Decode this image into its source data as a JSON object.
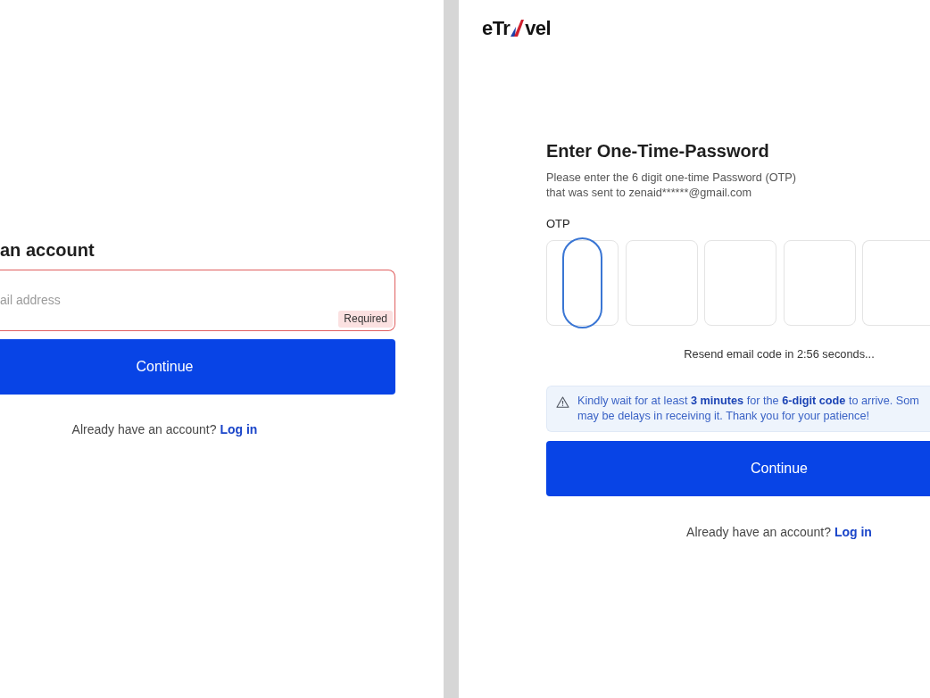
{
  "signup_panel": {
    "heading": "an account",
    "email_field": {
      "placeholder": "ail address",
      "invalid": true,
      "error_badge": "Required"
    },
    "continue_button": "Continue",
    "login_prompt": {
      "text": "Already have an account?",
      "link": "Log in"
    }
  },
  "otp_panel": {
    "logo": {
      "before": "eTr",
      "after": "vel"
    },
    "heading": "Enter One-Time-Password",
    "instructions": "Please enter the 6 digit one-time Password (OTP)\nthat was sent to zenaid******@gmail.com",
    "otp": {
      "label": "OTP",
      "boxes": [
        {
          "focused": true
        },
        {
          "focused": false
        },
        {
          "focused": false
        },
        {
          "focused": false
        },
        {
          "focused": false
        }
      ]
    },
    "resend_text": "Resend email code in 2:56 seconds...",
    "notice": "Kindly wait for at least **3 minutes** for the **6-digit code** to arrive. Som\nmay be delays in receiving it. Thank you for your patience!",
    "continue_button": "Continue",
    "login_prompt": {
      "text": "Already have an account?",
      "link": "Log in"
    }
  }
}
